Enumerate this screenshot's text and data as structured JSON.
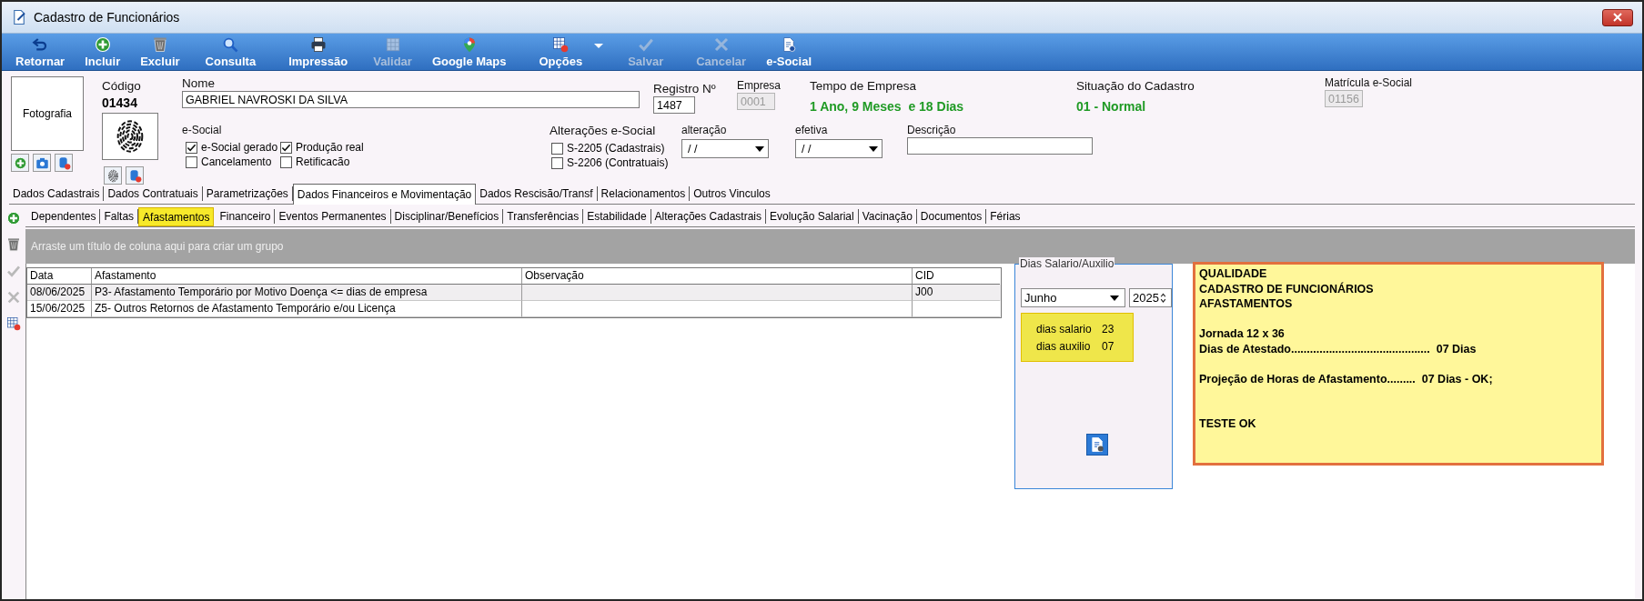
{
  "window": {
    "title": "Cadastro de Funcionários"
  },
  "toolbar": [
    {
      "label": "Retornar",
      "kind": "back",
      "disabled": false,
      "dropdown": false
    },
    {
      "label": "Incluir",
      "kind": "add",
      "disabled": false,
      "dropdown": false
    },
    {
      "label": "Excluir",
      "kind": "trash",
      "disabled": false,
      "dropdown": false
    },
    {
      "label": "Consulta",
      "kind": "search",
      "disabled": false,
      "dropdown": false
    },
    {
      "label": "Impressão",
      "kind": "print",
      "disabled": false,
      "dropdown": false
    },
    {
      "label": "Validar",
      "kind": "grid",
      "disabled": true,
      "dropdown": false
    },
    {
      "label": "Google Maps",
      "kind": "pin",
      "disabled": false,
      "dropdown": false
    },
    {
      "label": "Opções",
      "kind": "gridbadge",
      "disabled": false,
      "dropdown": true
    },
    {
      "label": "Salvar",
      "kind": "check",
      "disabled": true,
      "dropdown": false
    },
    {
      "label": "Cancelar",
      "kind": "cross",
      "disabled": true,
      "dropdown": false
    },
    {
      "label": "e-Social",
      "kind": "doc",
      "disabled": false,
      "dropdown": false
    }
  ],
  "header": {
    "photo": {
      "label": "Fotografia"
    },
    "codigo": {
      "label": "Código",
      "value": "01434"
    },
    "nome": {
      "label": "Nome",
      "value": "GABRIEL NAVROSKI DA SILVA"
    },
    "registro": {
      "label": "Registro Nº",
      "value": "1487"
    },
    "empresa": {
      "label": "Empresa",
      "value": "0001",
      "disabled": true
    },
    "tempo_empresa": {
      "label": "Tempo de Empresa",
      "value": "1 Ano, 9 Meses  e 18 Dias"
    },
    "situacao": {
      "label": "Situação do Cadastro",
      "value": "01 - Normal"
    },
    "matricula": {
      "label": "Matrícula e-Social",
      "value": "01156",
      "disabled": true
    },
    "esocial": {
      "label": "e-Social",
      "checkboxes": [
        {
          "label": "e-Social gerado",
          "checked": true
        },
        {
          "label": "Produção real",
          "checked": true
        },
        {
          "label": "Cancelamento",
          "checked": false
        },
        {
          "label": "Retificacão",
          "checked": false
        }
      ]
    },
    "alteracoes": {
      "label": "Alterações e-Social",
      "checkboxes": [
        {
          "label": "S-2205 (Cadastrais)",
          "checked": false
        },
        {
          "label": "S-2206 (Contratuais)",
          "checked": false
        }
      ]
    },
    "alteracao": {
      "label": "alteração",
      "value": "/ /"
    },
    "efetiva": {
      "label": "efetiva",
      "value": "/ /"
    },
    "descricao": {
      "label": "Descrição"
    }
  },
  "main_tabs": [
    {
      "label": "Dados Cadastrais",
      "selected": false
    },
    {
      "label": "Dados Contratuais",
      "selected": false
    },
    {
      "label": "Parametrizações",
      "selected": false
    },
    {
      "label": "Dados Financeiros e Movimentação",
      "selected": true
    },
    {
      "label": "Dados Rescisão/Transf",
      "selected": false
    },
    {
      "label": "Relacionamentos",
      "selected": false
    },
    {
      "label": "Outros Vinculos",
      "selected": false
    }
  ],
  "sub_tabs": [
    {
      "label": "Dependentes",
      "selected": false
    },
    {
      "label": "Faltas",
      "selected": false
    },
    {
      "label": "Afastamentos",
      "selected": true
    },
    {
      "label": "Financeiro",
      "selected": false
    },
    {
      "label": "Eventos Permanentes",
      "selected": false
    },
    {
      "label": "Disciplinar/Benefícios",
      "selected": false
    },
    {
      "label": "Transferências",
      "selected": false
    },
    {
      "label": "Estabilidade",
      "selected": false
    },
    {
      "label": "Alterações Cadastrais",
      "selected": false
    },
    {
      "label": "Evolução Salarial",
      "selected": false
    },
    {
      "label": "Vacinação",
      "selected": false
    },
    {
      "label": "Documentos",
      "selected": false
    },
    {
      "label": "Férias",
      "selected": false
    }
  ],
  "group_bar": {
    "text": "Arraste um título de coluna aqui para criar um grupo"
  },
  "table": {
    "columns": [
      "Data",
      "Afastamento",
      "Observação",
      "CID"
    ],
    "rows": [
      {
        "data": "08/06/2025",
        "afastamento": "P3- Afastamento Temporário por Motivo Doença <= dias de empresa",
        "cid": "J00"
      },
      {
        "data": "15/06/2025",
        "afastamento": "Z5- Outros Retornos de Afastamento Temporário e/ou Licença"
      }
    ]
  },
  "side_panel": {
    "title": "Dias Salario/Auxilio",
    "month": "Junho",
    "year": "2025",
    "summary": [
      {
        "label": "dias salario",
        "value": "23"
      },
      {
        "label": "dias auxilio",
        "value": "07"
      }
    ]
  },
  "note": {
    "text": "QUALIDADE\nCADASTRO DE FUNCIONÁRIOS\nAFASTAMENTOS\n\nJornada 12 x 36\nDias de Atestado............................................  07 Dias\n\nProjeção de Horas de Afastamento.........  07 Dias - OK;\n\n\nTESTE OK"
  }
}
